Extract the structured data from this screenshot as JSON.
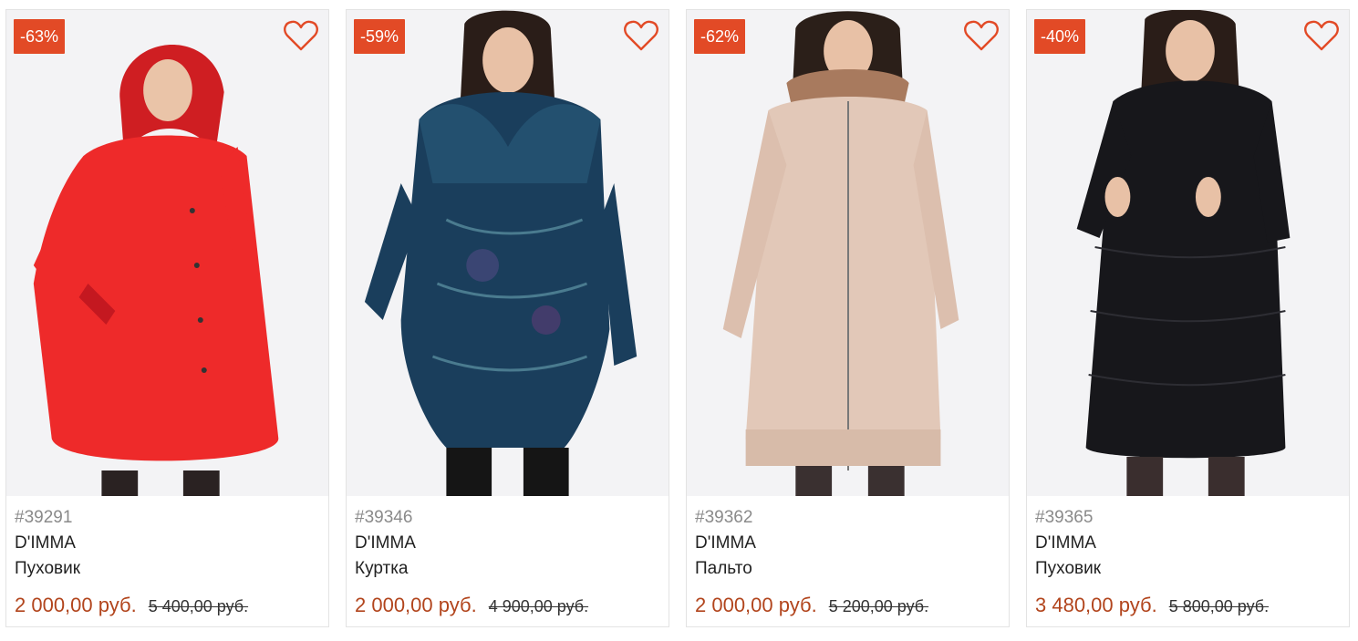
{
  "accent_color": "#e24a26",
  "price_color": "#b2451d",
  "products": [
    {
      "discount": "-63%",
      "sku": "#39291",
      "brand": "D'IMMA",
      "type": "Пуховик",
      "price": "2 000,00 руб.",
      "old_price": "5 400,00 руб.",
      "coat_color": "#ee2a2a",
      "icon": "heart-outline-icon"
    },
    {
      "discount": "-59%",
      "sku": "#39346",
      "brand": "D'IMMA",
      "type": "Куртка",
      "price": "2 000,00 руб.",
      "old_price": "4 900,00 руб.",
      "coat_color": "#1a3e5c",
      "icon": "heart-outline-icon"
    },
    {
      "discount": "-62%",
      "sku": "#39362",
      "brand": "D'IMMA",
      "type": "Пальто",
      "price": "2 000,00 руб.",
      "old_price": "5 200,00 руб.",
      "coat_color": "#e2c8b8",
      "icon": "heart-outline-icon"
    },
    {
      "discount": "-40%",
      "sku": "#39365",
      "brand": "D'IMMA",
      "type": "Пуховик",
      "price": "3 480,00 руб.",
      "old_price": "5 800,00 руб.",
      "coat_color": "#17171b",
      "icon": "heart-outline-icon"
    }
  ]
}
